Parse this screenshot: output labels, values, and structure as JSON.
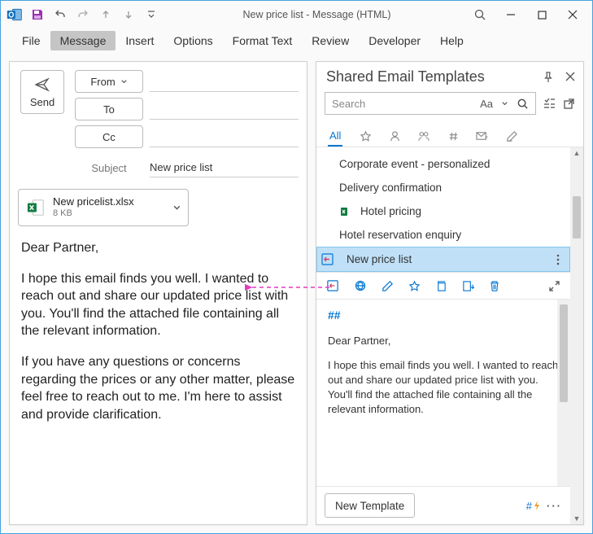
{
  "window": {
    "title_full": "New price list  -  Message (HTML)"
  },
  "menu": {
    "file": "File",
    "message": "Message",
    "insert": "Insert",
    "options": "Options",
    "format": "Format Text",
    "review": "Review",
    "developer": "Developer",
    "help": "Help"
  },
  "compose": {
    "send": "Send",
    "from": "From",
    "to": "To",
    "cc": "Cc",
    "subject_label": "Subject",
    "subject_value": "New price list",
    "attachment": {
      "name": "New pricelist.xlsx",
      "size": "8 KB"
    },
    "greeting": "Dear Partner,",
    "para1": "I hope this email finds you well. I wanted to reach out and share our updated price list with you. You'll find the attached file containing all the relevant information.",
    "para2": "If you have any questions or concerns regarding the prices or any other matter, please feel free to reach out to me. I'm here to assist and provide clarification."
  },
  "panel": {
    "title": "Shared Email Templates",
    "search_placeholder": "Search",
    "aa": "Aa",
    "tab_all": "All",
    "items": {
      "0": {
        "label": "Corporate event - personalized"
      },
      "1": {
        "label": "Delivery confirmation"
      },
      "2": {
        "label": "Hotel pricing"
      },
      "3": {
        "label": "Hotel reservation enquiry"
      },
      "4": {
        "label": "New price list"
      }
    },
    "preview": {
      "marker": "##",
      "greeting": "Dear Partner,",
      "body": "I hope this email finds you well. I wanted to reach out and share our updated price list with you. You'll find the attached file containing all the relevant information."
    },
    "new_template": "New Template"
  }
}
